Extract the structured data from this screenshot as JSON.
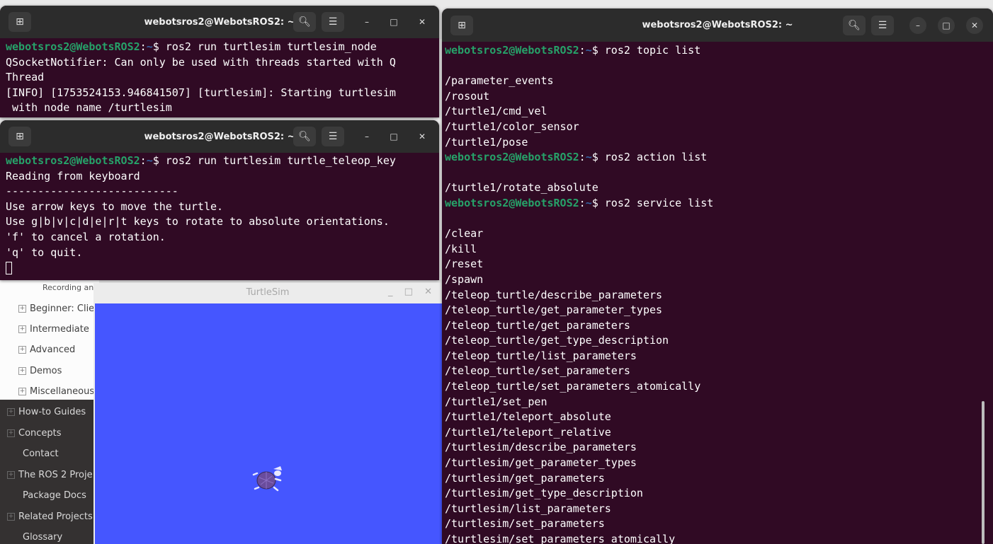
{
  "docs": {
    "recording": "Recording an",
    "items": [
      "Beginner: Clie",
      "Intermediate",
      "Advanced",
      "Demos",
      "Miscellaneous"
    ],
    "dark_items": [
      {
        "label": "How-to Guides",
        "expandable": true
      },
      {
        "label": "Concepts",
        "expandable": true
      },
      {
        "label": "Contact",
        "expandable": false
      },
      {
        "label": "The ROS 2 Proje",
        "expandable": true
      },
      {
        "label": "Package Docs",
        "expandable": false
      },
      {
        "label": "Related Projects",
        "expandable": true
      },
      {
        "label": "Glossary",
        "expandable": false
      }
    ]
  },
  "prompt": {
    "user": "webotsros2@WebotsROS2",
    "path": "~",
    "sep": ":",
    "dollar": "$ "
  },
  "terminal1": {
    "title": "webotsros2@WebotsROS2: ~",
    "command": "ros2 run turtlesim turtlesim_node",
    "output": [
      "QSocketNotifier: Can only be used with threads started with Q",
      "Thread",
      "[INFO] [1753524153.946841507] [turtlesim]: Starting turtlesim",
      " with node name /turtlesim"
    ]
  },
  "terminal2": {
    "title": "webotsros2@WebotsROS2: ~",
    "command": "ros2 run turtlesim turtle_teleop_key",
    "output": [
      "Reading from keyboard",
      "---------------------------",
      "Use arrow keys to move the turtle.",
      "Use g|b|v|c|d|e|r|t keys to rotate to absolute orientations.",
      "'f' to cancel a rotation.",
      "'q' to quit."
    ]
  },
  "terminal3": {
    "title": "webotsros2@WebotsROS2: ~",
    "lines": [
      {
        "type": "prompt",
        "cmd": "ros2 topic list"
      },
      {
        "type": "text",
        "text": ""
      },
      {
        "type": "text",
        "text": "/parameter_events"
      },
      {
        "type": "text",
        "text": "/rosout"
      },
      {
        "type": "text",
        "text": "/turtle1/cmd_vel"
      },
      {
        "type": "text",
        "text": "/turtle1/color_sensor"
      },
      {
        "type": "text",
        "text": "/turtle1/pose"
      },
      {
        "type": "prompt",
        "cmd": "ros2 action list"
      },
      {
        "type": "text",
        "text": ""
      },
      {
        "type": "text",
        "text": "/turtle1/rotate_absolute"
      },
      {
        "type": "prompt",
        "cmd": "ros2 service list"
      },
      {
        "type": "text",
        "text": ""
      },
      {
        "type": "text",
        "text": "/clear"
      },
      {
        "type": "text",
        "text": "/kill"
      },
      {
        "type": "text",
        "text": "/reset"
      },
      {
        "type": "text",
        "text": "/spawn"
      },
      {
        "type": "text",
        "text": "/teleop_turtle/describe_parameters"
      },
      {
        "type": "text",
        "text": "/teleop_turtle/get_parameter_types"
      },
      {
        "type": "text",
        "text": "/teleop_turtle/get_parameters"
      },
      {
        "type": "text",
        "text": "/teleop_turtle/get_type_description"
      },
      {
        "type": "text",
        "text": "/teleop_turtle/list_parameters"
      },
      {
        "type": "text",
        "text": "/teleop_turtle/set_parameters"
      },
      {
        "type": "text",
        "text": "/teleop_turtle/set_parameters_atomically"
      },
      {
        "type": "text",
        "text": "/turtle1/set_pen"
      },
      {
        "type": "text",
        "text": "/turtle1/teleport_absolute"
      },
      {
        "type": "text",
        "text": "/turtle1/teleport_relative"
      },
      {
        "type": "text",
        "text": "/turtlesim/describe_parameters"
      },
      {
        "type": "text",
        "text": "/turtlesim/get_parameter_types"
      },
      {
        "type": "text",
        "text": "/turtlesim/get_parameters"
      },
      {
        "type": "text",
        "text": "/turtlesim/get_type_description"
      },
      {
        "type": "text",
        "text": "/turtlesim/list_parameters"
      },
      {
        "type": "text",
        "text": "/turtlesim/set_parameters"
      },
      {
        "type": "text",
        "text": "/turtlesim/set_parameters_atomically"
      }
    ]
  },
  "turtlesim": {
    "title": "TurtleSim",
    "controls": "_ □ ✕",
    "background": "#4556ff"
  },
  "colors": {
    "terminal_bg": "#300a24",
    "prompt_user": "#26a269",
    "prompt_path": "#3465a4",
    "titlebar": "#2c2c2c"
  },
  "icons": {
    "new_tab": "new-tab-icon",
    "search": "search-icon",
    "menu": "hamburger-menu-icon",
    "minimize": "minimize-icon",
    "maximize": "maximize-icon",
    "close": "close-icon"
  }
}
